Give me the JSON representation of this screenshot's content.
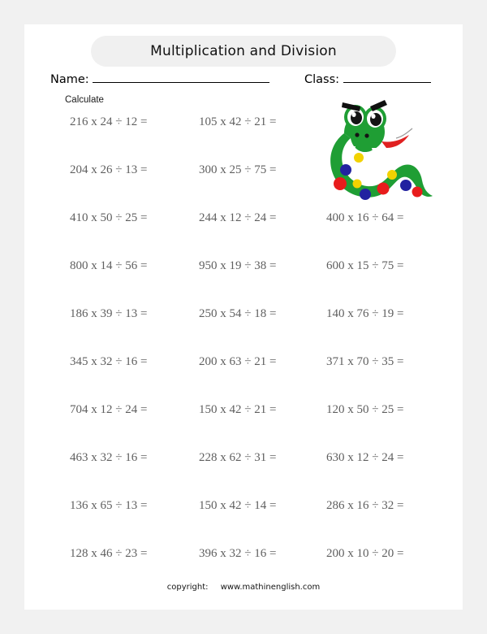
{
  "page": {
    "title": "Multiplication and Division",
    "background_color": "#f1f1f1",
    "sheet_color": "#ffffff",
    "banner_color": "#f0f0f0"
  },
  "fields": {
    "name_label": "Name:",
    "class_label": "Class:"
  },
  "instruction": "Calculate",
  "problems": [
    {
      "c1": "216 x 24 ÷ 12 =",
      "c2": "105 x 42 ÷ 21 =",
      "c3": ""
    },
    {
      "c1": "204 x 26 ÷ 13 =",
      "c2": "300 x 25 ÷ 75 =",
      "c3": ""
    },
    {
      "c1": "410 x 50 ÷ 25 =",
      "c2": "244 x 12 ÷ 24 =",
      "c3": "400 x 16 ÷ 64 ="
    },
    {
      "c1": "800 x 14 ÷ 56 =",
      "c2": "950 x 19 ÷ 38 =",
      "c3": "600 x 15 ÷ 75 ="
    },
    {
      "c1": "186 x 39 ÷ 13 =",
      "c2": "250 x 54 ÷ 18 =",
      "c3": "140 x 76 ÷ 19 ="
    },
    {
      "c1": "345 x 32 ÷ 16 =",
      "c2": "200 x 63 ÷ 21 =",
      "c3": "371 x 70 ÷ 35 ="
    },
    {
      "c1": "704 x 12 ÷ 24 =",
      "c2": "150 x 42 ÷ 21 =",
      "c3": "120 x 50 ÷ 25 ="
    },
    {
      "c1": "463 x 32 ÷ 16 =",
      "c2": "228 x 62 ÷ 31 =",
      "c3": "630 x 12 ÷ 24 ="
    },
    {
      "c1": "136 x 65 ÷ 13 =",
      "c2": "150 x 42 ÷ 14 =",
      "c3": "286 x 16 ÷ 32 ="
    },
    {
      "c1": "128 x 46 ÷ 23 =",
      "c2": "396 x 32 ÷ 16 =",
      "c3": "200 x 10 ÷ 20 ="
    }
  ],
  "illustration": {
    "name": "snake-mascot",
    "body_color": "#1f9e34",
    "eyebrow_color": "#101010",
    "tongue_color": "#e02020",
    "dot_colors": [
      "#f2d200",
      "#2222a0",
      "#e81c1c"
    ]
  },
  "footer": {
    "copyright_label": "copyright:",
    "site": "www.mathinenglish.com"
  }
}
